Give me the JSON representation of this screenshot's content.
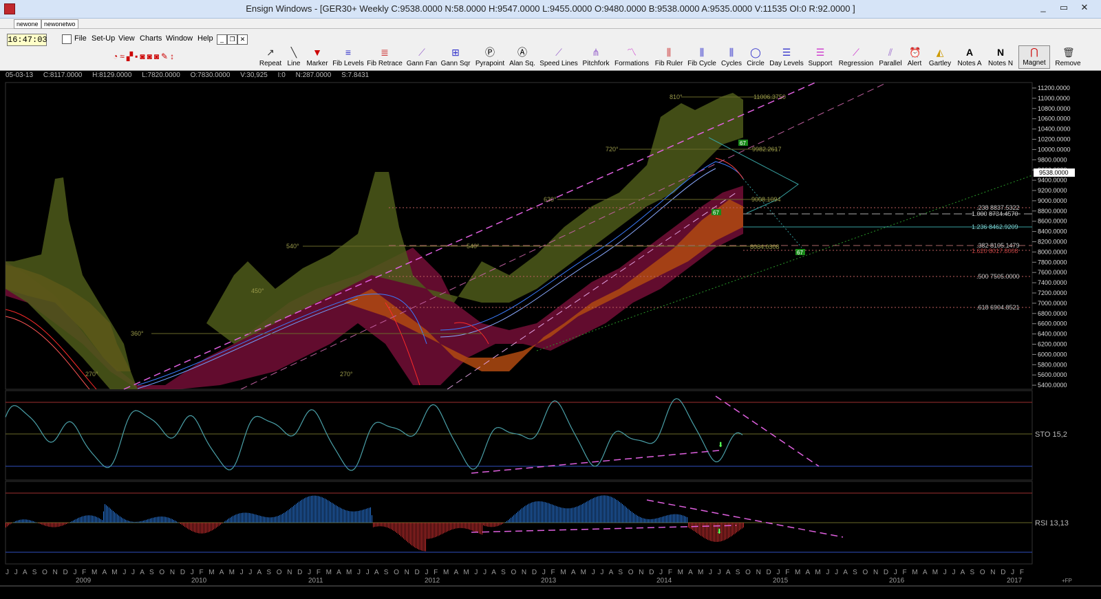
{
  "window": {
    "title": "Ensign Windows - [GER30+ Weekly C:9538.0000 N:58.0000 H:9547.0000 L:9455.0000 O:9480.0000 B:9538.0000 A:9535.0000 V:11535 OI:0 R:92.0000 ]",
    "min": "_",
    "max": "▭",
    "close": "✕"
  },
  "tabs": [
    "newone",
    "newonetwo"
  ],
  "clock": "16:47:03",
  "menu": [
    "File",
    "Set-Up",
    "View",
    "Charts",
    "Window",
    "Help"
  ],
  "toolbar": [
    "Repeat",
    "Line",
    "Marker",
    "Fib Levels",
    "Fib Retrace",
    "Gann Fan",
    "Gann Sqr",
    "Pyrapoint",
    "Alan Sq.",
    "Speed Lines",
    "Pitchfork",
    "Formations",
    "Fib Ruler",
    "Fib Cycle",
    "Cycles",
    "Circle",
    "Day Levels",
    "Support",
    "Regression",
    "Parallel",
    "Alert",
    "Gartley",
    "Notes A",
    "Notes N",
    "Magnet",
    "Remove"
  ],
  "info": {
    "date": "05-03-13",
    "c": "C:8117.0000",
    "h": "H:8129.0000",
    "l": "L:7820.0000",
    "o": "O:7830.0000",
    "v": "V:30,925",
    "i": "I:0",
    "n": "N:287.0000",
    "s": "S:7.8431"
  },
  "price_axis": [
    "11200.0000",
    "11000.0000",
    "10800.0000",
    "10600.0000",
    "10400.0000",
    "10200.0000",
    "10000.0000",
    "9800.0000",
    "9600.0000",
    "9400.0000",
    "9200.0000",
    "9000.0000",
    "8800.0000",
    "8600.0000",
    "8400.0000",
    "8200.0000",
    "8000.0000",
    "7800.0000",
    "7600.0000",
    "7400.0000",
    "7200.0000",
    "7000.0000",
    "6800.0000",
    "6600.0000",
    "6400.0000",
    "6200.0000",
    "6000.0000",
    "5800.0000",
    "5600.0000",
    "5400.0000"
  ],
  "current_price": "9538.0000",
  "fib_labels": [
    ".238  8837.5322",
    "1.000  8734.4570",
    "1.236  8462.9209",
    ".382  8105.1479",
    "1.620  8017.8008",
    ".500  7505.0000",
    ".618  6904.8521"
  ],
  "gann_labels": [
    "810°",
    "720°",
    "630°",
    "540°",
    "540°",
    "450°",
    "360°",
    "270°",
    "270°"
  ],
  "level_labels": [
    "11006.3750",
    "9982.2617",
    "9008.1094",
    "8084.0308"
  ],
  "markers": [
    "67",
    "67",
    "67"
  ],
  "sto_label": "STO  15,2",
  "rsi_label": "RSI  13,13",
  "months": "J J A S O N D J F M A M J J A S O N D J F M A M J J A S O N D J F M A M J J A S O N D J F M A M J J A S O N D J F M A M J J A S O N D J F M A M J J A S O N D J F M A M J J A S O N D J F M A M J J A S O N D J F",
  "years": [
    "2009",
    "2010",
    "2011",
    "2012",
    "2013",
    "2014",
    "2015",
    "2016",
    "2017"
  ],
  "corner": "+FP"
}
